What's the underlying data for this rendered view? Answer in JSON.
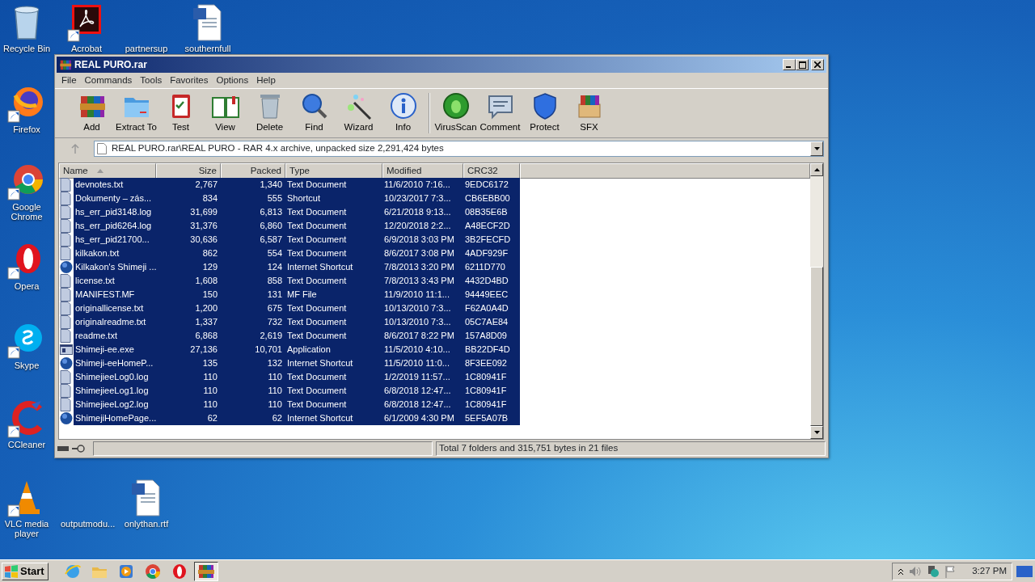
{
  "desktop_icons": [
    {
      "label": "Recycle Bin",
      "kind": "recycle"
    },
    {
      "label": "Acrobat",
      "kind": "pdf"
    },
    {
      "label": "partnersup",
      "kind": "blank"
    },
    {
      "label": "southernfull",
      "kind": "doc"
    },
    {
      "label": "Firefox",
      "kind": "firefox"
    },
    {
      "label": "Google Chrome",
      "kind": "chrome"
    },
    {
      "label": "Opera",
      "kind": "opera"
    },
    {
      "label": "Skype",
      "kind": "skype"
    },
    {
      "label": "CCleaner",
      "kind": "ccleaner"
    },
    {
      "label": "VLC media player",
      "kind": "vlc"
    },
    {
      "label": "outputmodu...",
      "kind": "blank"
    },
    {
      "label": "onlythan.rtf",
      "kind": "doc"
    }
  ],
  "window": {
    "title": "REAL PURO.rar",
    "menu": [
      "File",
      "Commands",
      "Tools",
      "Favorites",
      "Options",
      "Help"
    ],
    "toolbar": [
      {
        "label": "Add",
        "kind": "add"
      },
      {
        "label": "Extract To",
        "kind": "extract"
      },
      {
        "label": "Test",
        "kind": "test"
      },
      {
        "label": "View",
        "kind": "view"
      },
      {
        "label": "Delete",
        "kind": "delete"
      },
      {
        "label": "Find",
        "kind": "find"
      },
      {
        "label": "Wizard",
        "kind": "wizard"
      },
      {
        "label": "Info",
        "kind": "info"
      },
      {
        "label": "VirusScan",
        "kind": "virusscan"
      },
      {
        "label": "Comment",
        "kind": "comment"
      },
      {
        "label": "Protect",
        "kind": "protect"
      },
      {
        "label": "SFX",
        "kind": "sfx"
      }
    ],
    "address": "REAL PURO.rar\\REAL PURO - RAR 4.x archive, unpacked size 2,291,424 bytes",
    "columns": [
      {
        "label": "Name",
        "sorted": true
      },
      {
        "label": "Size",
        "sorted": false
      },
      {
        "label": "Packed",
        "sorted": false
      },
      {
        "label": "Type",
        "sorted": false
      },
      {
        "label": "Modified",
        "sorted": false
      },
      {
        "label": "CRC32",
        "sorted": false
      }
    ],
    "rows": [
      {
        "name": "devnotes.txt",
        "size": "2,767",
        "packed": "1,340",
        "type": "Text Document",
        "modified": "11/6/2010 7:16...",
        "crc": "9EDC6172",
        "kind": "text",
        "selected": true
      },
      {
        "name": "Dokumenty – zás...",
        "size": "834",
        "packed": "555",
        "type": "Shortcut",
        "modified": "10/23/2017 7:3...",
        "crc": "CB6EBB00",
        "kind": "text",
        "selected": true
      },
      {
        "name": "hs_err_pid3148.log",
        "size": "31,699",
        "packed": "6,813",
        "type": "Text Document",
        "modified": "6/21/2018 9:13...",
        "crc": "08B35E6B",
        "kind": "text",
        "selected": true
      },
      {
        "name": "hs_err_pid6264.log",
        "size": "31,376",
        "packed": "6,860",
        "type": "Text Document",
        "modified": "12/20/2018 2:2...",
        "crc": "A48ECF2D",
        "kind": "text",
        "selected": true
      },
      {
        "name": "hs_err_pid21700...",
        "size": "30,636",
        "packed": "6,587",
        "type": "Text Document",
        "modified": "6/9/2018 3:03 PM",
        "crc": "3B2FECFD",
        "kind": "text",
        "selected": true
      },
      {
        "name": "kilkakon.txt",
        "size": "862",
        "packed": "554",
        "type": "Text Document",
        "modified": "8/6/2017 3:08 PM",
        "crc": "4ADF929F",
        "kind": "text",
        "selected": true
      },
      {
        "name": "Kilkakon's Shimeji ...",
        "size": "129",
        "packed": "124",
        "type": "Internet Shortcut",
        "modified": "7/8/2013 3:20 PM",
        "crc": "6211D770",
        "kind": "globe",
        "selected": true
      },
      {
        "name": "license.txt",
        "size": "1,608",
        "packed": "858",
        "type": "Text Document",
        "modified": "7/8/2013 3:43 PM",
        "crc": "4432D4BD",
        "kind": "text",
        "selected": true
      },
      {
        "name": "MANIFEST.MF",
        "size": "150",
        "packed": "131",
        "type": "MF File",
        "modified": "11/9/2010 11:1...",
        "crc": "94449EEC",
        "kind": "text",
        "selected": true
      },
      {
        "name": "originallicense.txt",
        "size": "1,200",
        "packed": "675",
        "type": "Text Document",
        "modified": "10/13/2010 7:3...",
        "crc": "F62A0A4D",
        "kind": "text",
        "selected": true
      },
      {
        "name": "originalreadme.txt",
        "size": "1,337",
        "packed": "732",
        "type": "Text Document",
        "modified": "10/13/2010 7:3...",
        "crc": "05C7AE84",
        "kind": "text",
        "selected": true
      },
      {
        "name": "readme.txt",
        "size": "6,868",
        "packed": "2,619",
        "type": "Text Document",
        "modified": "8/6/2017 8:22 PM",
        "crc": "157A8D09",
        "kind": "text",
        "selected": true
      },
      {
        "name": "Shimeji-ee.exe",
        "size": "27,136",
        "packed": "10,701",
        "type": "Application",
        "modified": "11/5/2010 4:10...",
        "crc": "BB22DF4D",
        "kind": "app",
        "selected": true
      },
      {
        "name": "Shimeji-eeHomeP...",
        "size": "135",
        "packed": "132",
        "type": "Internet Shortcut",
        "modified": "11/5/2010 11:0...",
        "crc": "8F3EE092",
        "kind": "globe",
        "selected": true
      },
      {
        "name": "ShimejieeLog0.log",
        "size": "110",
        "packed": "110",
        "type": "Text Document",
        "modified": "1/2/2019 11:57...",
        "crc": "1C80941F",
        "kind": "text",
        "selected": true
      },
      {
        "name": "ShimejieeLog1.log",
        "size": "110",
        "packed": "110",
        "type": "Text Document",
        "modified": "6/8/2018 12:47...",
        "crc": "1C80941F",
        "kind": "text",
        "selected": true
      },
      {
        "name": "ShimejieeLog2.log",
        "size": "110",
        "packed": "110",
        "type": "Text Document",
        "modified": "6/8/2018 12:47...",
        "crc": "1C80941F",
        "kind": "text",
        "selected": true
      },
      {
        "name": "ShimejiHomePage...",
        "size": "62",
        "packed": "62",
        "type": "Internet Shortcut",
        "modified": "6/1/2009 4:30 PM",
        "crc": "5EF5A07B",
        "kind": "globe",
        "selected": true
      }
    ],
    "status": "Total 7 folders and 315,751 bytes in 21 files"
  },
  "taskbar": {
    "start": "Start",
    "apps": [
      {
        "kind": "ie",
        "active": false
      },
      {
        "kind": "explorer",
        "active": false
      },
      {
        "kind": "media",
        "active": false
      },
      {
        "kind": "chrome",
        "active": false
      },
      {
        "kind": "opera",
        "active": false
      },
      {
        "kind": "winrar",
        "active": true
      }
    ],
    "clock": "3:27 PM"
  }
}
